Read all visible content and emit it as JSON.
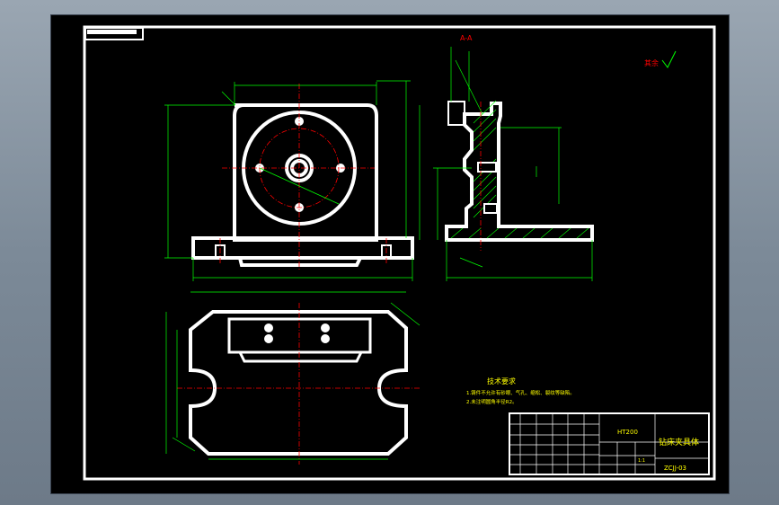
{
  "section_label": "A-A",
  "roughness_note": "其余",
  "tech_req": {
    "title": "技术要求",
    "items": [
      "1.铸件不允许有砂眼、气孔、缩松、裂纹等缺陷。",
      "2.未注明圆角半径R2。"
    ]
  },
  "title_block": {
    "material": "HT200",
    "part_name": "钻床夹具体",
    "drawing_no": "ZCJJ-03",
    "scale": "1:1"
  },
  "colors": {
    "background": "#000000",
    "outline": "#ffffff",
    "dimension": "#00ff00",
    "centerline": "#ff0000",
    "hatch": "#00ff00",
    "text_yellow": "#ffff00"
  }
}
